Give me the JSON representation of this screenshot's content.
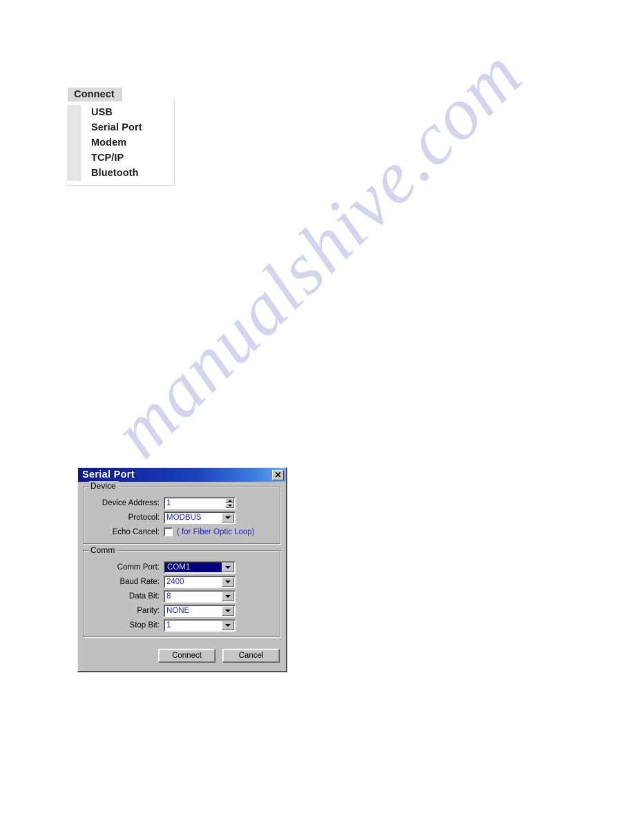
{
  "page": {
    "background_color": "#ffffff",
    "watermark_text": "manualshive.com",
    "watermark_color": "#b9bce4"
  },
  "connect_menu": {
    "tab_label": "Connect",
    "items": [
      {
        "label": "USB"
      },
      {
        "label": "Serial Port"
      },
      {
        "label": "Modem"
      },
      {
        "label": "TCP/IP"
      },
      {
        "label": "Bluetooth"
      }
    ]
  },
  "serial_dialog": {
    "title": "Serial Port",
    "close_glyph": "✕",
    "accent_color": "#000080",
    "value_text_color": "#2222cc",
    "device_group": {
      "title": "Device",
      "device_address": {
        "label": "Device Address:",
        "value": "1"
      },
      "protocol": {
        "label": "Protocol:",
        "value": "MODBUS",
        "options": [
          "MODBUS"
        ]
      },
      "echo_cancel": {
        "label": "Echo Cancel:",
        "checked": false,
        "hint": "( for Fiber Optic Loop)"
      }
    },
    "comm_group": {
      "title": "Comm",
      "fields": [
        {
          "label": "Comm Port:",
          "value": "COM1",
          "selected": true,
          "options": [
            "COM1"
          ]
        },
        {
          "label": "Baud Rate:",
          "value": "2400",
          "selected": false,
          "options": [
            "2400"
          ]
        },
        {
          "label": "Data Bit:",
          "value": "8",
          "selected": false,
          "options": [
            "8"
          ]
        },
        {
          "label": "Parity:",
          "value": "NONE",
          "selected": false,
          "options": [
            "NONE"
          ]
        },
        {
          "label": "Stop Bit:",
          "value": "1",
          "selected": false,
          "options": [
            "1"
          ]
        }
      ]
    },
    "buttons": {
      "connect_label": "Connect",
      "cancel_label": "Cancel"
    }
  }
}
